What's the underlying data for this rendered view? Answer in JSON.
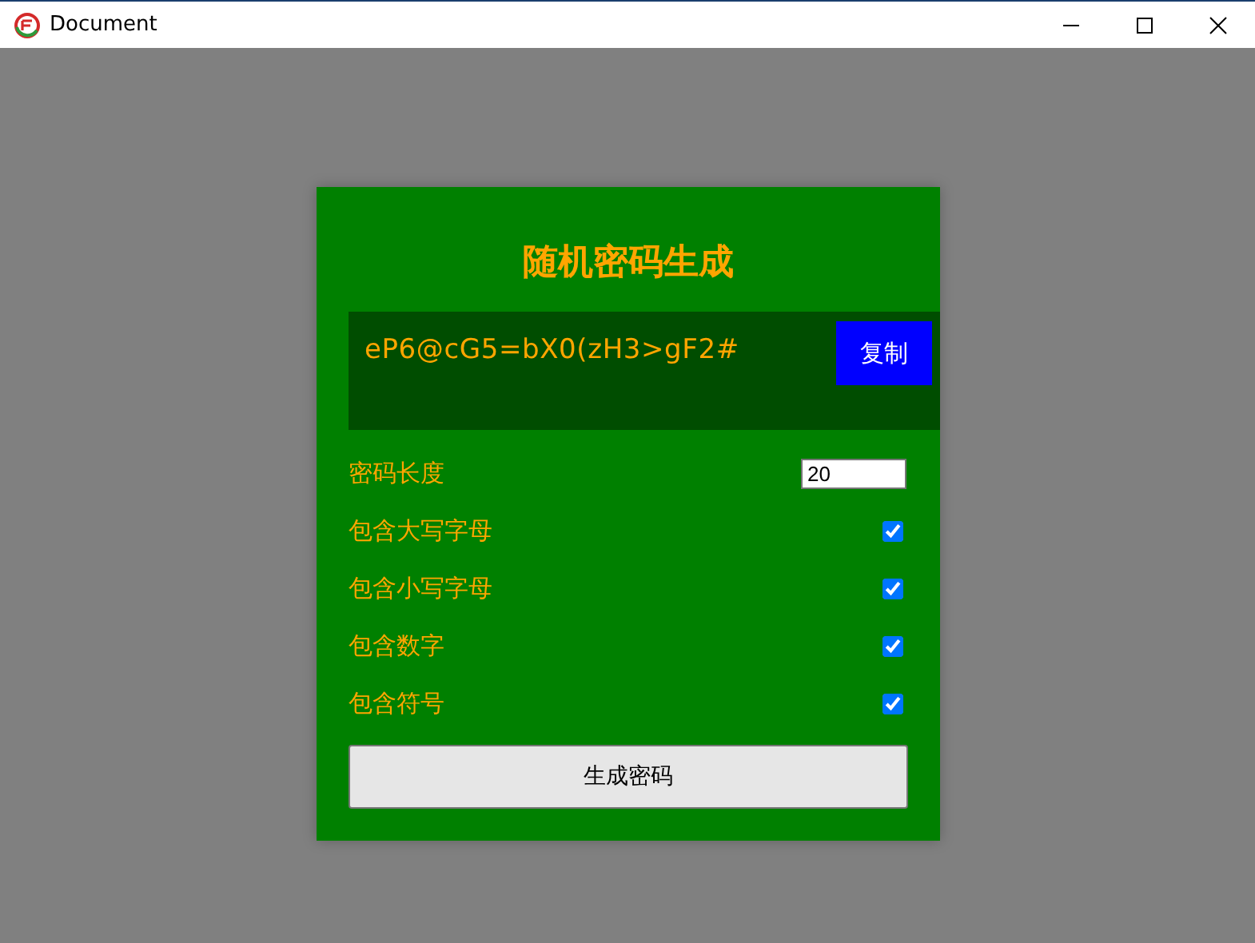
{
  "window": {
    "title": "Document"
  },
  "card": {
    "title": "随机密码生成",
    "password": "eP6@cG5=bX0(zH3>gF2#",
    "copy_button": "复制",
    "options": [
      {
        "kind": "number",
        "label": "密码长度",
        "value": "20"
      },
      {
        "kind": "checkbox",
        "label": "包含大写字母",
        "checked": true
      },
      {
        "kind": "checkbox",
        "label": "包含小写字母",
        "checked": true
      },
      {
        "kind": "checkbox",
        "label": "包含数字",
        "checked": true
      },
      {
        "kind": "checkbox",
        "label": "包含符号",
        "checked": true
      }
    ],
    "generate_button": "生成密码"
  }
}
